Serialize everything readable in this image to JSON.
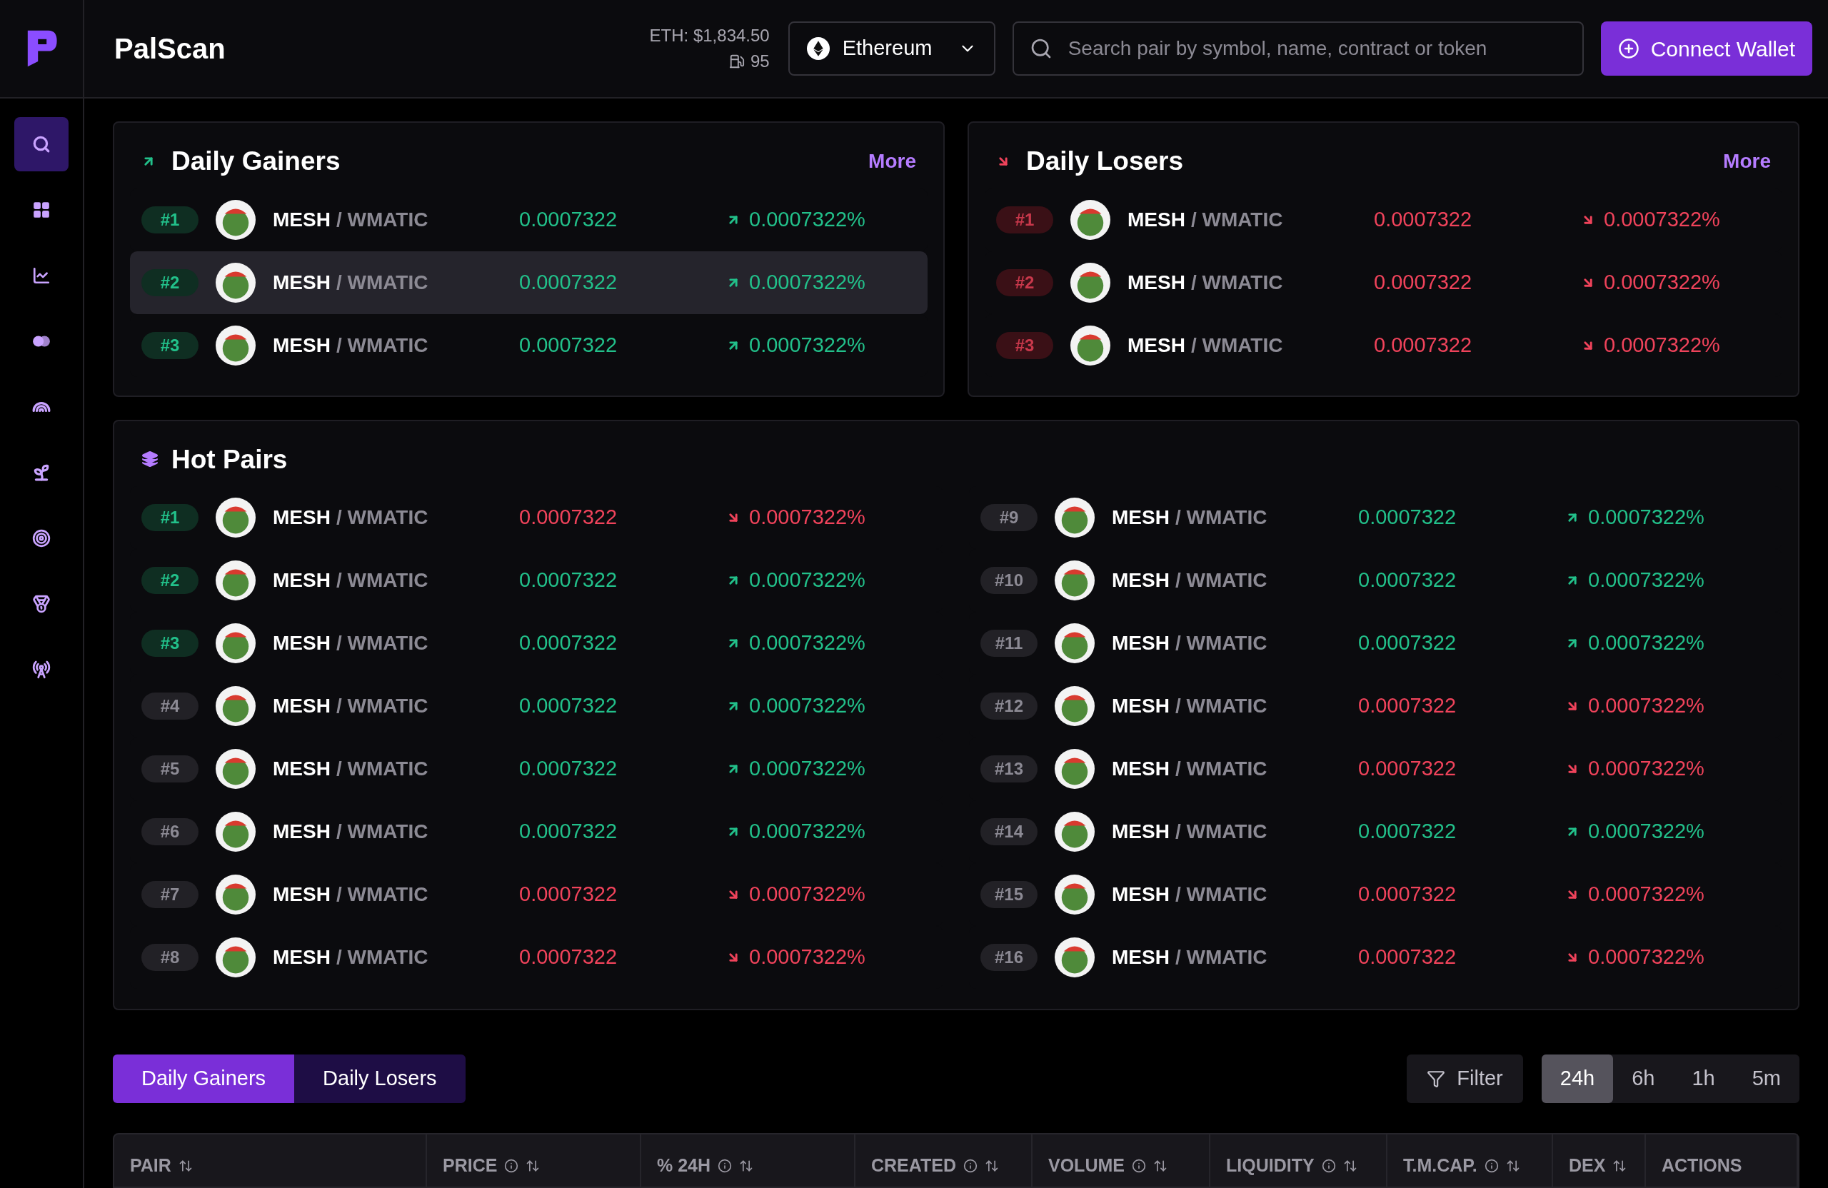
{
  "app": {
    "title": "PalScan"
  },
  "header": {
    "eth_price": "ETH: $1,834.50",
    "gas": "95",
    "network": "Ethereum",
    "search": {
      "placeholder": "Search pair by symbol, name, contract or token"
    },
    "connect_button": "Connect Wallet"
  },
  "sidebar": {
    "items": [
      {
        "kind": "search",
        "selected": true
      },
      {
        "kind": "grid",
        "selected": false
      },
      {
        "kind": "chart",
        "selected": false
      },
      {
        "kind": "circles",
        "selected": false
      },
      {
        "kind": "rainbow",
        "selected": false
      },
      {
        "kind": "plant",
        "selected": false
      },
      {
        "kind": "target",
        "selected": false
      },
      {
        "kind": "medal",
        "selected": false
      },
      {
        "kind": "tower",
        "selected": false
      }
    ]
  },
  "daily_gainers": {
    "title": "Daily Gainers",
    "kind": "up",
    "more": "More",
    "rows": [
      {
        "rank": "#1",
        "base": "MESH",
        "quote": "/ WMATIC",
        "price": "0.0007322",
        "change": "0.0007322%",
        "rising": true,
        "highlighted": false
      },
      {
        "rank": "#2",
        "base": "MESH",
        "quote": "/ WMATIC",
        "price": "0.0007322",
        "change": "0.0007322%",
        "rising": true,
        "highlighted": true
      },
      {
        "rank": "#3",
        "base": "MESH",
        "quote": "/ WMATIC",
        "price": "0.0007322",
        "change": "0.0007322%",
        "rising": true,
        "highlighted": false
      }
    ]
  },
  "daily_losers": {
    "title": "Daily Losers",
    "kind": "down",
    "more": "More",
    "rows": [
      {
        "rank": "#1",
        "base": "MESH",
        "quote": "/ WMATIC",
        "price": "0.0007322",
        "change": "0.0007322%",
        "rising": false,
        "highlighted": false
      },
      {
        "rank": "#2",
        "base": "MESH",
        "quote": "/ WMATIC",
        "price": "0.0007322",
        "change": "0.0007322%",
        "rising": false,
        "highlighted": false
      },
      {
        "rank": "#3",
        "base": "MESH",
        "quote": "/ WMATIC",
        "price": "0.0007322",
        "change": "0.0007322%",
        "rising": false,
        "highlighted": false
      }
    ]
  },
  "hot_pairs": {
    "title": "Hot Pairs",
    "rows": [
      {
        "rank": "#1",
        "top": true,
        "base": "MESH",
        "quote": "/ WMATIC",
        "price": "0.0007322",
        "change": "0.0007322%",
        "rising": false
      },
      {
        "rank": "#2",
        "top": true,
        "base": "MESH",
        "quote": "/ WMATIC",
        "price": "0.0007322",
        "change": "0.0007322%",
        "rising": true
      },
      {
        "rank": "#3",
        "top": true,
        "base": "MESH",
        "quote": "/ WMATIC",
        "price": "0.0007322",
        "change": "0.0007322%",
        "rising": true
      },
      {
        "rank": "#4",
        "top": false,
        "base": "MESH",
        "quote": "/ WMATIC",
        "price": "0.0007322",
        "change": "0.0007322%",
        "rising": true
      },
      {
        "rank": "#5",
        "top": false,
        "base": "MESH",
        "quote": "/ WMATIC",
        "price": "0.0007322",
        "change": "0.0007322%",
        "rising": true
      },
      {
        "rank": "#6",
        "top": false,
        "base": "MESH",
        "quote": "/ WMATIC",
        "price": "0.0007322",
        "change": "0.0007322%",
        "rising": true
      },
      {
        "rank": "#7",
        "top": false,
        "base": "MESH",
        "quote": "/ WMATIC",
        "price": "0.0007322",
        "change": "0.0007322%",
        "rising": false
      },
      {
        "rank": "#8",
        "top": false,
        "base": "MESH",
        "quote": "/ WMATIC",
        "price": "0.0007322",
        "change": "0.0007322%",
        "rising": false
      },
      {
        "rank": "#9",
        "top": false,
        "base": "MESH",
        "quote": "/ WMATIC",
        "price": "0.0007322",
        "change": "0.0007322%",
        "rising": true
      },
      {
        "rank": "#10",
        "top": false,
        "base": "MESH",
        "quote": "/ WMATIC",
        "price": "0.0007322",
        "change": "0.0007322%",
        "rising": true
      },
      {
        "rank": "#11",
        "top": false,
        "base": "MESH",
        "quote": "/ WMATIC",
        "price": "0.0007322",
        "change": "0.0007322%",
        "rising": true
      },
      {
        "rank": "#12",
        "top": false,
        "base": "MESH",
        "quote": "/ WMATIC",
        "price": "0.0007322",
        "change": "0.0007322%",
        "rising": false
      },
      {
        "rank": "#13",
        "top": false,
        "base": "MESH",
        "quote": "/ WMATIC",
        "price": "0.0007322",
        "change": "0.0007322%",
        "rising": false
      },
      {
        "rank": "#14",
        "top": false,
        "base": "MESH",
        "quote": "/ WMATIC",
        "price": "0.0007322",
        "change": "0.0007322%",
        "rising": true
      },
      {
        "rank": "#15",
        "top": false,
        "base": "MESH",
        "quote": "/ WMATIC",
        "price": "0.0007322",
        "change": "0.0007322%",
        "rising": false
      },
      {
        "rank": "#16",
        "top": false,
        "base": "MESH",
        "quote": "/ WMATIC",
        "price": "0.0007322",
        "change": "0.0007322%",
        "rising": false
      }
    ]
  },
  "list_tabs": [
    {
      "label": "Daily Gainers",
      "selected": true
    },
    {
      "label": "Daily Losers",
      "selected": false
    }
  ],
  "filter_button": "Filter",
  "time_tabs": [
    {
      "label": "24h",
      "selected": true
    },
    {
      "label": "6h",
      "selected": false
    },
    {
      "label": "1h",
      "selected": false
    },
    {
      "label": "5m",
      "selected": false
    }
  ],
  "table": {
    "columns": [
      {
        "label": "PAIR",
        "info": false,
        "sortable": true
      },
      {
        "label": "PRICE",
        "info": true,
        "sortable": true
      },
      {
        "label": "% 24H",
        "info": true,
        "sortable": true
      },
      {
        "label": "CREATED",
        "info": true,
        "sortable": true
      },
      {
        "label": "VOLUME",
        "info": true,
        "sortable": true
      },
      {
        "label": "LIQUIDITY",
        "info": true,
        "sortable": true
      },
      {
        "label": "T.M.CAP.",
        "info": true,
        "sortable": true
      },
      {
        "label": "DEX",
        "info": false,
        "sortable": true
      },
      {
        "label": "ACTIONS",
        "info": false,
        "sortable": false
      }
    ]
  }
}
